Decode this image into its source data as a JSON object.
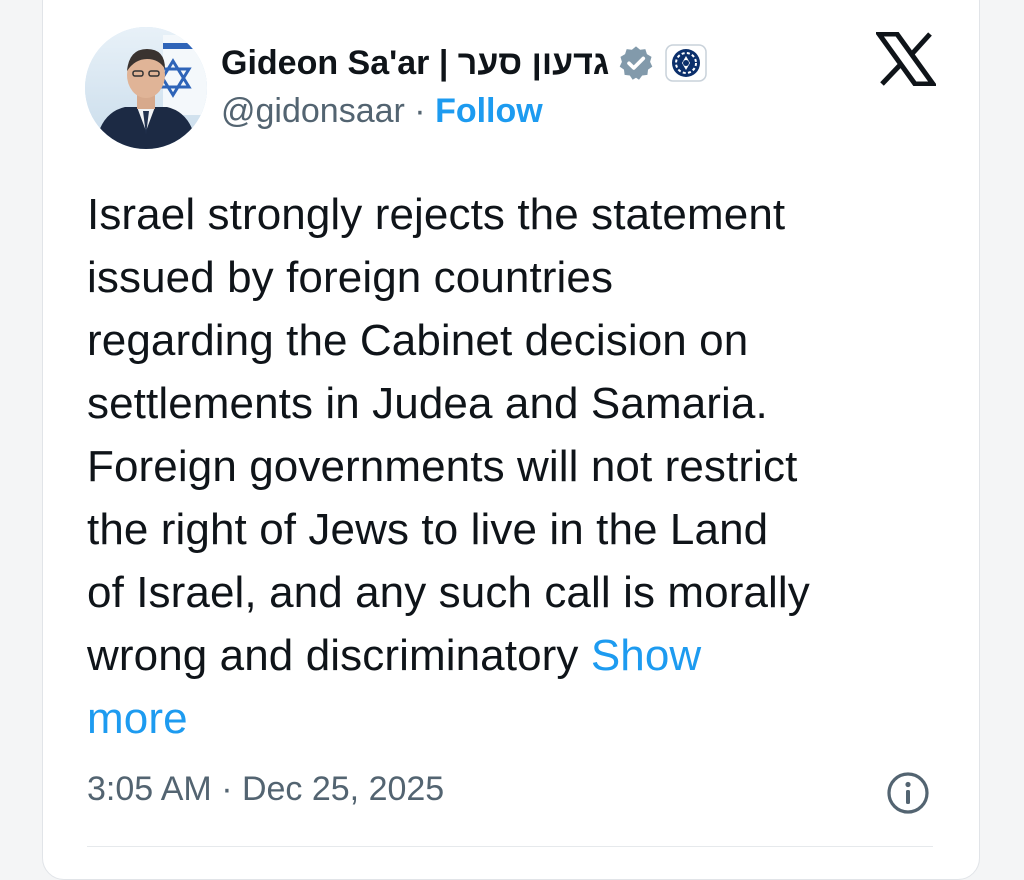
{
  "tweet": {
    "author": {
      "display_name": "Gideon Sa'ar | גדעון סער",
      "handle": "@gidonsaar",
      "separator": " · ",
      "follow_label": "Follow",
      "verified": true
    },
    "platform_icon": "x-logo-icon",
    "text_lines": [
      "Israel strongly rejects the statement",
      "issued by foreign countries",
      "regarding the Cabinet decision on",
      "settlements in Judea and Samaria.",
      "Foreign governments will not restrict",
      "the right of Jews to live in the Land",
      "of Israel, and any such call is morally",
      "wrong and discriminatory "
    ],
    "show_more_label_1": "Show",
    "show_more_label_2": "more",
    "timestamp": "3:05 AM · Dec 25, 2025",
    "info_icon": "info-icon"
  },
  "colors": {
    "link_blue": "#1d9bf0",
    "text_primary": "#0f1419",
    "text_secondary": "#536471",
    "verified_badge": "#829aab"
  }
}
